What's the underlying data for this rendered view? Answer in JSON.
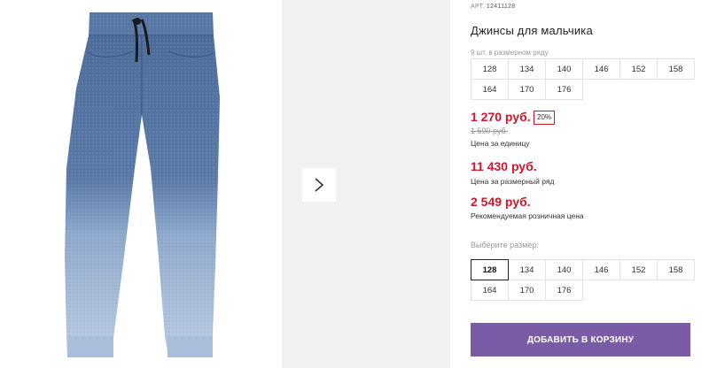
{
  "product": {
    "sku_label": "АРТ.",
    "sku": "12411128",
    "title": "Джинсы для мальчика",
    "image_alt": "jeans-photo"
  },
  "sizes_info": {
    "note": "9 шт. в размерном ряду",
    "sizes": [
      "128",
      "134",
      "140",
      "146",
      "152",
      "158",
      "164",
      "170",
      "176"
    ]
  },
  "pricing": {
    "unit_price": "1 270 руб.",
    "discount": "20%",
    "old_price": "1 590 руб.",
    "unit_caption": "Цена за единицу",
    "set_price": "11 430 руб.",
    "set_caption": "Цена за размерный ряд",
    "rrp_price": "2 549 руб.",
    "rrp_caption": "Рекомендуемая розничная цена"
  },
  "size_picker": {
    "label": "Выберите размер:",
    "selected": "128",
    "options": [
      "128",
      "134",
      "140",
      "146",
      "152",
      "158",
      "164",
      "170",
      "176"
    ]
  },
  "cart": {
    "button_label": "ДОБАВИТЬ В КОРЗИНУ"
  },
  "colors": {
    "price_red": "#d0162c",
    "button_purple": "#7a5ca6",
    "denim_dark": "#4f6f9c",
    "denim_light": "#b9cbe2"
  },
  "icons": {
    "next": "chevron-right-icon"
  }
}
